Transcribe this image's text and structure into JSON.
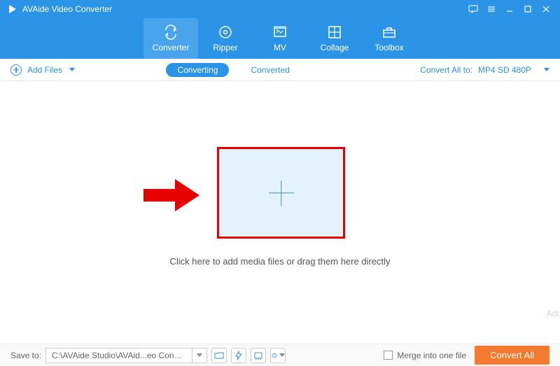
{
  "titlebar": {
    "app_name": "AVAide Video Converter"
  },
  "nav": {
    "items": [
      {
        "label": "Converter"
      },
      {
        "label": "Ripper"
      },
      {
        "label": "MV"
      },
      {
        "label": "Collage"
      },
      {
        "label": "Toolbox"
      }
    ]
  },
  "secondbar": {
    "add_files": "Add Files",
    "tab_converting": "Converting",
    "tab_converted": "Converted",
    "convert_all_label": "Convert All to:",
    "format_selected": "MP4 SD 480P"
  },
  "main": {
    "hint": "Click here to add media files or drag them here directly"
  },
  "bottombar": {
    "save_to_label": "Save to:",
    "save_path": "C:\\AVAide Studio\\AVAid...eo Converter\\Converted",
    "merge_label": "Merge into one file",
    "convert_button": "Convert All"
  },
  "watermark": "Act"
}
